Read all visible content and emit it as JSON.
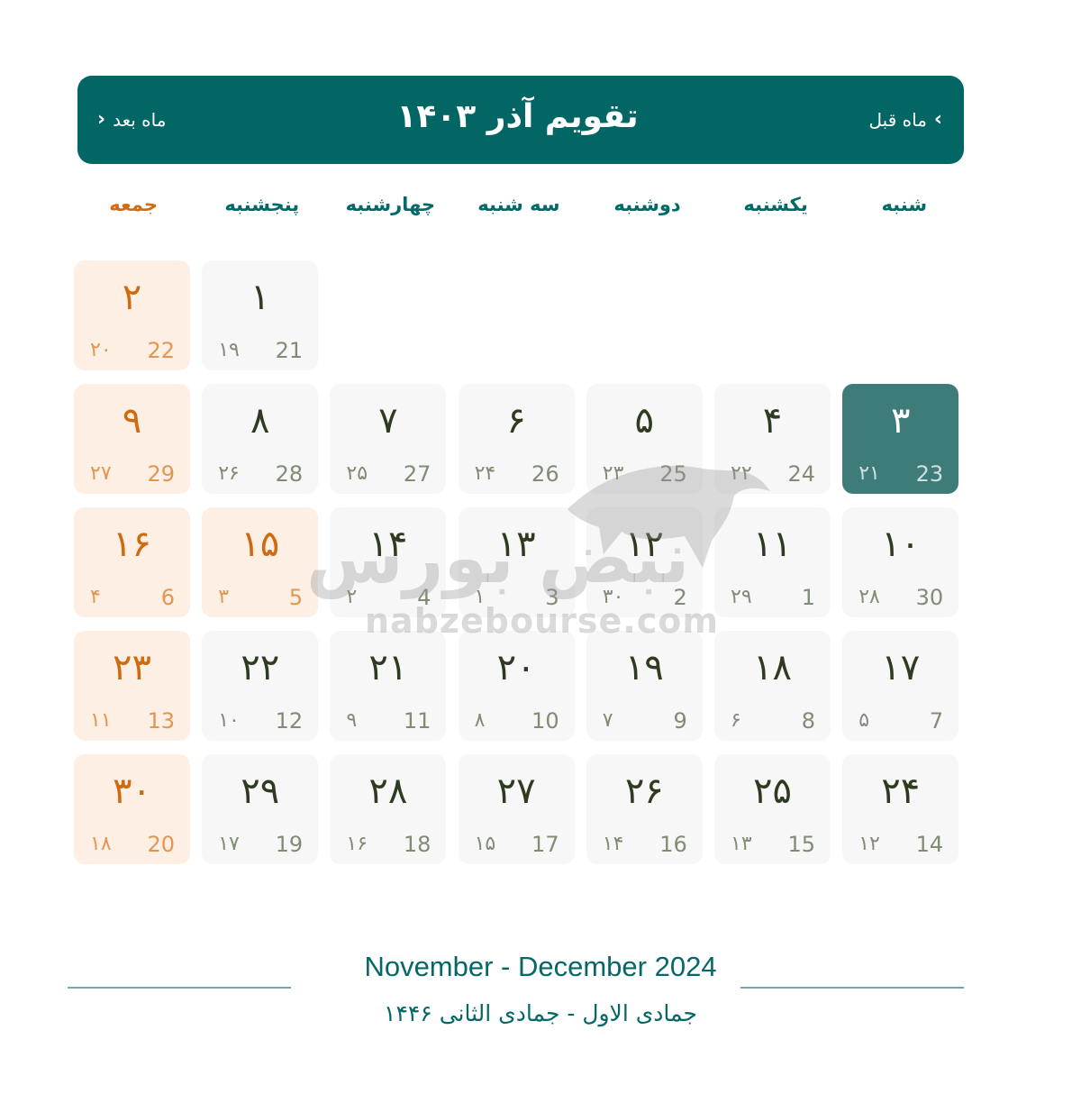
{
  "header": {
    "title": "تقویم آذر ۱۴۰۳",
    "prev_label": "ماه قبل",
    "next_label": "ماه بعد",
    "prev_icon": "chevron-right",
    "next_icon": "chevron-left"
  },
  "weekdays": [
    "شنبه",
    "یکشنبه",
    "دوشنبه",
    "سه شنبه",
    "چهارشنبه",
    "پنجشنبه",
    "جمعه"
  ],
  "colors": {
    "primary": "#026664",
    "today": "#3e7c79",
    "holiday_bg": "#fdefe3",
    "holiday_text": "#cf6a0f",
    "cell_bg": "#f7f7f7"
  },
  "days": [
    {
      "j": "۱",
      "g": "21",
      "h": "۱۹",
      "col": 5,
      "row": 0,
      "type": "normal"
    },
    {
      "j": "۲",
      "g": "22",
      "h": "۲۰",
      "col": 6,
      "row": 0,
      "type": "holiday"
    },
    {
      "j": "۳",
      "g": "23",
      "h": "۲۱",
      "col": 0,
      "row": 1,
      "type": "today"
    },
    {
      "j": "۴",
      "g": "24",
      "h": "۲۲",
      "col": 1,
      "row": 1,
      "type": "normal"
    },
    {
      "j": "۵",
      "g": "25",
      "h": "۲۳",
      "col": 2,
      "row": 1,
      "type": "normal"
    },
    {
      "j": "۶",
      "g": "26",
      "h": "۲۴",
      "col": 3,
      "row": 1,
      "type": "normal"
    },
    {
      "j": "۷",
      "g": "27",
      "h": "۲۵",
      "col": 4,
      "row": 1,
      "type": "normal"
    },
    {
      "j": "۸",
      "g": "28",
      "h": "۲۶",
      "col": 5,
      "row": 1,
      "type": "normal"
    },
    {
      "j": "۹",
      "g": "29",
      "h": "۲۷",
      "col": 6,
      "row": 1,
      "type": "holiday"
    },
    {
      "j": "۱۰",
      "g": "30",
      "h": "۲۸",
      "col": 0,
      "row": 2,
      "type": "normal"
    },
    {
      "j": "۱۱",
      "g": "1",
      "h": "۲۹",
      "col": 1,
      "row": 2,
      "type": "normal"
    },
    {
      "j": "۱۲",
      "g": "2",
      "h": "۳۰",
      "col": 2,
      "row": 2,
      "type": "normal"
    },
    {
      "j": "۱۳",
      "g": "3",
      "h": "۱",
      "col": 3,
      "row": 2,
      "type": "normal"
    },
    {
      "j": "۱۴",
      "g": "4",
      "h": "۲",
      "col": 4,
      "row": 2,
      "type": "normal"
    },
    {
      "j": "۱۵",
      "g": "5",
      "h": "۳",
      "col": 5,
      "row": 2,
      "type": "holiday"
    },
    {
      "j": "۱۶",
      "g": "6",
      "h": "۴",
      "col": 6,
      "row": 2,
      "type": "holiday"
    },
    {
      "j": "۱۷",
      "g": "7",
      "h": "۵",
      "col": 0,
      "row": 3,
      "type": "normal"
    },
    {
      "j": "۱۸",
      "g": "8",
      "h": "۶",
      "col": 1,
      "row": 3,
      "type": "normal"
    },
    {
      "j": "۱۹",
      "g": "9",
      "h": "۷",
      "col": 2,
      "row": 3,
      "type": "normal"
    },
    {
      "j": "۲۰",
      "g": "10",
      "h": "۸",
      "col": 3,
      "row": 3,
      "type": "normal"
    },
    {
      "j": "۲۱",
      "g": "11",
      "h": "۹",
      "col": 4,
      "row": 3,
      "type": "normal"
    },
    {
      "j": "۲۲",
      "g": "12",
      "h": "۱۰",
      "col": 5,
      "row": 3,
      "type": "normal"
    },
    {
      "j": "۲۳",
      "g": "13",
      "h": "۱۱",
      "col": 6,
      "row": 3,
      "type": "holiday"
    },
    {
      "j": "۲۴",
      "g": "14",
      "h": "۱۲",
      "col": 0,
      "row": 4,
      "type": "normal"
    },
    {
      "j": "۲۵",
      "g": "15",
      "h": "۱۳",
      "col": 1,
      "row": 4,
      "type": "normal"
    },
    {
      "j": "۲۶",
      "g": "16",
      "h": "۱۴",
      "col": 2,
      "row": 4,
      "type": "normal"
    },
    {
      "j": "۲۷",
      "g": "17",
      "h": "۱۵",
      "col": 3,
      "row": 4,
      "type": "normal"
    },
    {
      "j": "۲۸",
      "g": "18",
      "h": "۱۶",
      "col": 4,
      "row": 4,
      "type": "normal"
    },
    {
      "j": "۲۹",
      "g": "19",
      "h": "۱۷",
      "col": 5,
      "row": 4,
      "type": "normal"
    },
    {
      "j": "۳۰",
      "g": "20",
      "h": "۱۸",
      "col": 6,
      "row": 4,
      "type": "holiday"
    }
  ],
  "watermark": {
    "logo_text": "نبض بورس",
    "url": "nabzebourse.com"
  },
  "footer": {
    "gregorian": "November - December  2024",
    "hijri": "جمادی الاول - جمادی الثانی  ۱۴۴۶"
  }
}
